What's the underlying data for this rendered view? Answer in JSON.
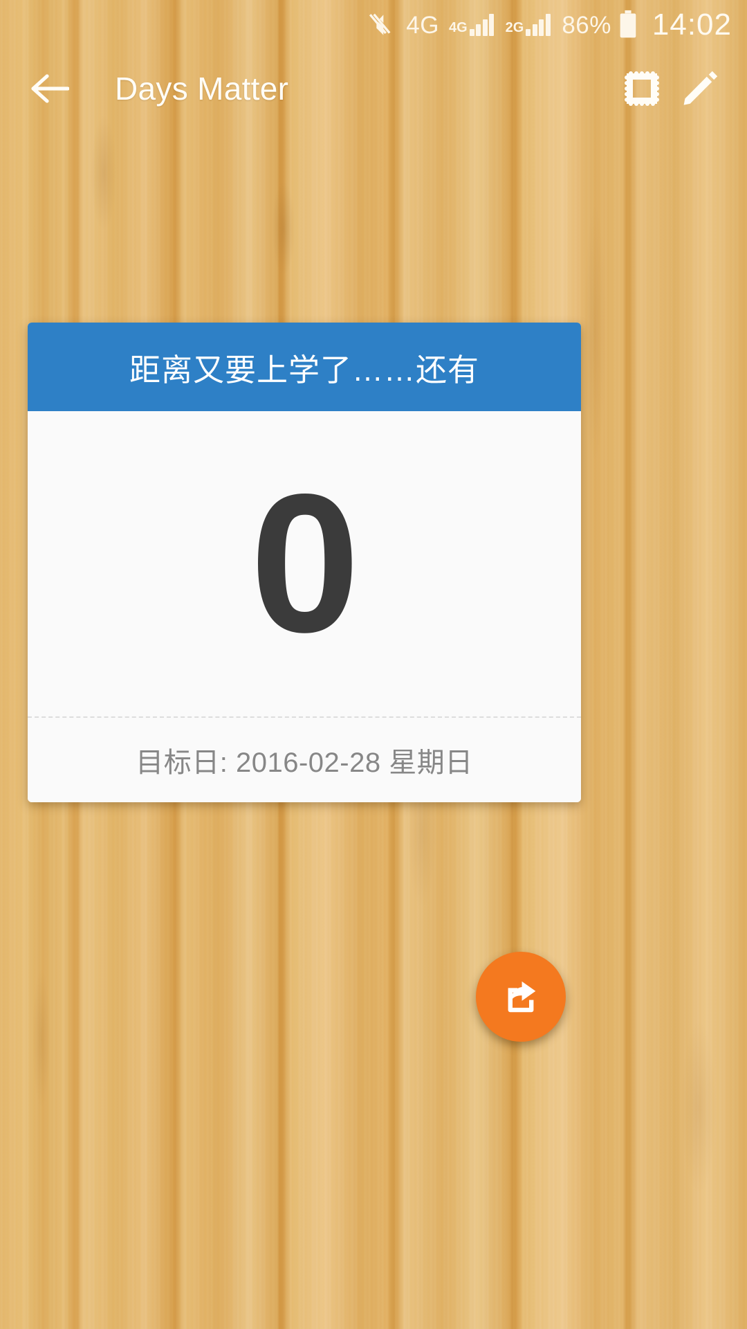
{
  "statusbar": {
    "icons": [
      {
        "name": "sound-mute-icon",
        "label": ""
      },
      {
        "name": "network-4g-label",
        "label": "4G"
      },
      {
        "name": "sim1-network-label",
        "label": "4G"
      },
      {
        "name": "sim2-network-label",
        "label": "2G"
      }
    ],
    "battery_percent": "86%",
    "clock": "14:02"
  },
  "appbar": {
    "title": "Days Matter",
    "back_icon": "back-arrow-icon",
    "stamp_icon": "stamp-icon",
    "edit_icon": "pencil-edit-icon"
  },
  "card": {
    "title": "距离又要上学了……还有",
    "day_count": "0",
    "target_date": "目标日: 2016-02-28 星期日",
    "header_color": "#2e80c6"
  },
  "fab": {
    "icon": "share-icon",
    "color": "#f4791f"
  }
}
